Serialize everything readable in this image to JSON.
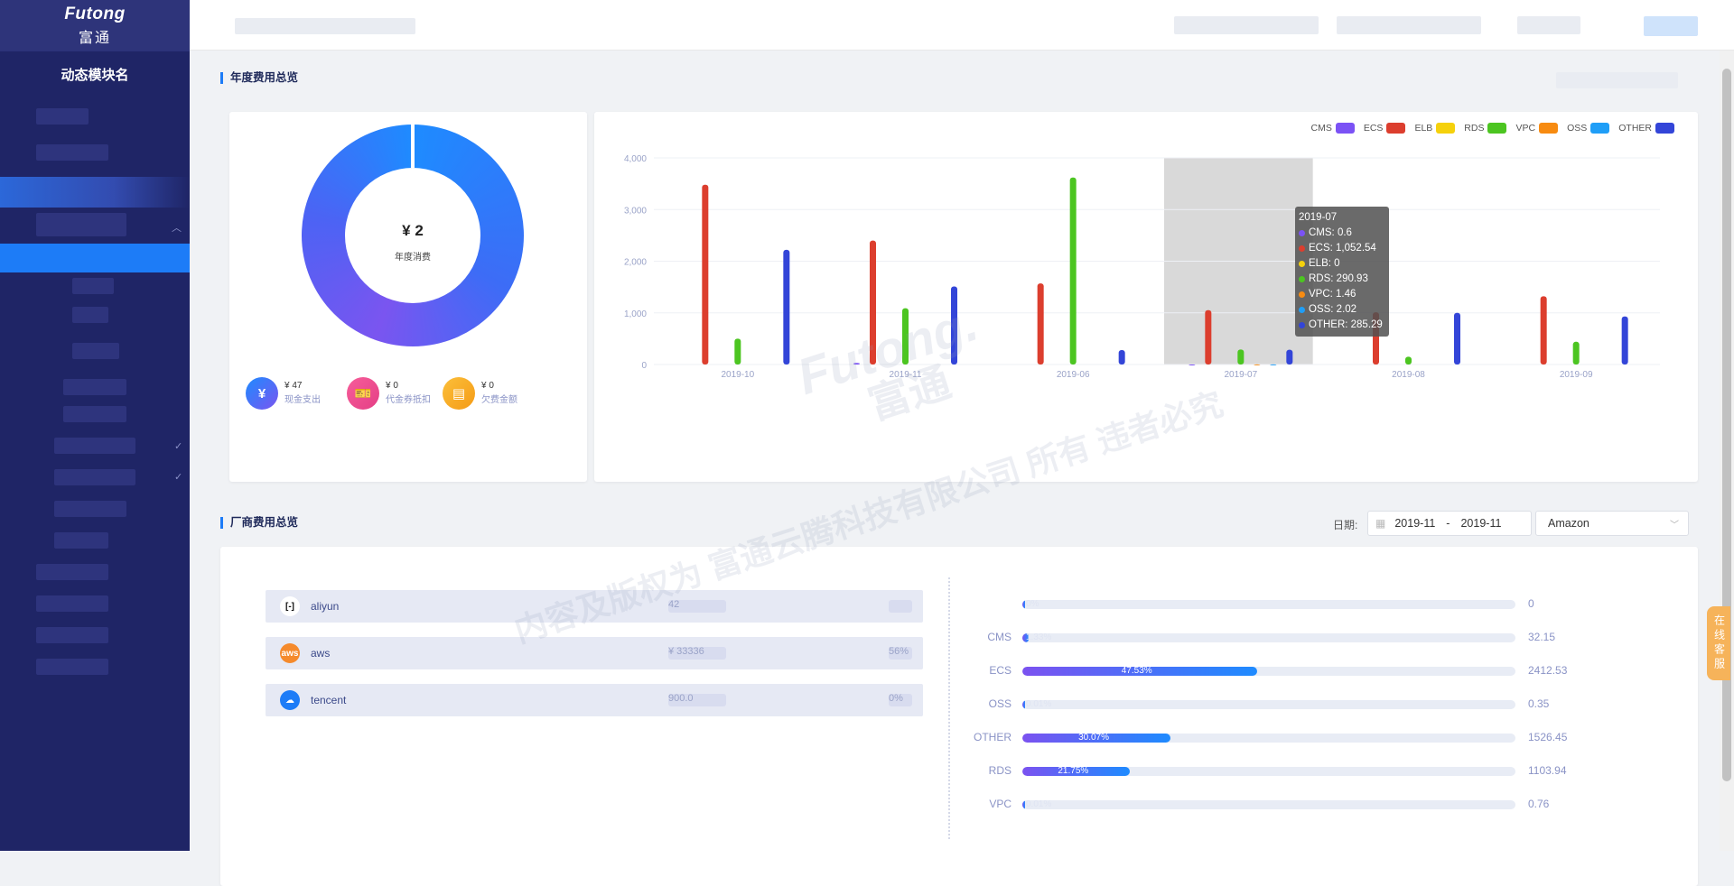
{
  "brand": {
    "name": "Futong",
    "name_cn": "富通"
  },
  "sidebar": {
    "module_name": "动态模块名"
  },
  "annual": {
    "title": "年度费用总览",
    "donut": {
      "value": "¥ 2",
      "label": "年度消费"
    },
    "stats": [
      {
        "icon": "yen-icon",
        "value": "¥ 47",
        "label": "现金支出",
        "color": "#3f6ff5"
      },
      {
        "icon": "ticket-icon",
        "value": "¥ 0",
        "label": "代金券抵扣",
        "color": "#f04c8e"
      },
      {
        "icon": "invoice-icon",
        "value": "¥ 0",
        "label": "欠费金额",
        "color": "#f6a623"
      }
    ]
  },
  "chart_data": {
    "type": "bar",
    "categories": [
      "2019-10",
      "2019-11",
      "2019-06",
      "2019-07",
      "2019-08",
      "2019-09"
    ],
    "ylim": [
      0,
      4000
    ],
    "yticks": [
      "0",
      "1,000",
      "2,000",
      "3,000",
      "4,000"
    ],
    "grid": true,
    "legend_position": "top-right",
    "series": [
      {
        "name": "CMS",
        "color": "#7b52f5",
        "values": [
          0,
          30,
          0,
          0.6,
          0,
          0
        ]
      },
      {
        "name": "ECS",
        "color": "#dc3e2e",
        "values": [
          3480,
          2400,
          1570,
          1052.54,
          1010,
          1320
        ]
      },
      {
        "name": "ELB",
        "color": "#f5d10c",
        "values": [
          0,
          0,
          0,
          0,
          0,
          0
        ]
      },
      {
        "name": "RDS",
        "color": "#4cc521",
        "values": [
          500,
          1090,
          3620,
          290.93,
          150,
          440
        ]
      },
      {
        "name": "VPC",
        "color": "#f78b11",
        "values": [
          0,
          0,
          0,
          1.46,
          0,
          0
        ]
      },
      {
        "name": "OSS",
        "color": "#1f9ef7",
        "values": [
          0,
          0,
          0,
          2.02,
          0,
          0
        ]
      },
      {
        "name": "OTHER",
        "color": "#3345d8",
        "values": [
          2220,
          1510,
          280,
          285.29,
          1000,
          930
        ]
      }
    ],
    "highlight_category": "2019-07",
    "tooltip": {
      "title": "2019-07",
      "rows": [
        {
          "text": "CMS: 0.6",
          "color": "#7b52f5"
        },
        {
          "text": "ECS: 1,052.54",
          "color": "#dc3e2e"
        },
        {
          "text": "ELB: 0",
          "color": "#f5d10c"
        },
        {
          "text": "RDS: 290.93",
          "color": "#4cc521"
        },
        {
          "text": "VPC: 1.46",
          "color": "#f78b11"
        },
        {
          "text": "OSS: 2.02",
          "color": "#1f9ef7"
        },
        {
          "text": "OTHER: 285.29",
          "color": "#3345d8"
        }
      ]
    }
  },
  "vendor": {
    "title": "厂商费用总览",
    "date_label": "日期:",
    "date_start": "2019-11",
    "date_sep": "-",
    "date_end": "2019-11",
    "vendor_select": "Amazon",
    "vendors": [
      {
        "name": "aliyun",
        "icon": "aliyun-icon",
        "icon_text": "[-]",
        "color": "#ffffff",
        "text_color": "#111111",
        "amount": "42",
        "percent": ""
      },
      {
        "name": "aws",
        "icon": "aws-icon",
        "icon_text": "aws",
        "color": "#f58a2c",
        "text_color": "#ffffff",
        "amount": "¥ 33336",
        "percent": "56%"
      },
      {
        "name": "tencent",
        "icon": "tencent-icon",
        "icon_text": "☁",
        "color": "#1d7cf7",
        "text_color": "#ffffff",
        "amount": "900.0",
        "percent": "0%"
      }
    ],
    "services": [
      {
        "name": "",
        "percent": "0%",
        "pct_value": 0,
        "value": "0"
      },
      {
        "name": "CMS",
        "percent": "1.33%",
        "pct_value": 0.0133,
        "value": "32.15"
      },
      {
        "name": "ECS",
        "percent": "47.53%",
        "pct_value": 0.4753,
        "value": "2412.53"
      },
      {
        "name": "OSS",
        "percent": "0.01%",
        "pct_value": 0.0001,
        "value": "0.35"
      },
      {
        "name": "OTHER",
        "percent": "30.07%",
        "pct_value": 0.3007,
        "value": "1526.45"
      },
      {
        "name": "RDS",
        "percent": "21.75%",
        "pct_value": 0.2175,
        "value": "1103.94"
      },
      {
        "name": "VPC",
        "percent": "0.01%",
        "pct_value": 0.0001,
        "value": "0.76"
      }
    ]
  },
  "watermark": {
    "line1": "Futong.",
    "line2": "富通",
    "line3": "内容及版权为 富通云腾科技有限公司 所有 违者必究"
  },
  "online_service": "在线客服"
}
